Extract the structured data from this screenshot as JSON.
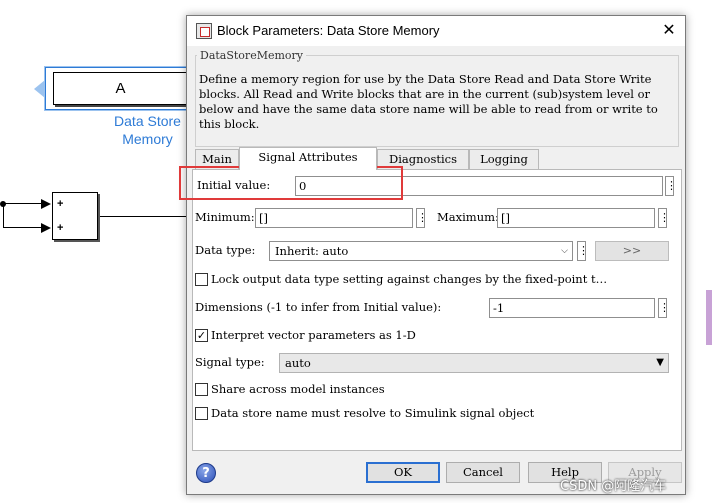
{
  "canvas": {
    "dsm_block_label": "A",
    "dsm_caption_line1": "Data Store",
    "dsm_caption_line2": "Memory",
    "sum_signs": [
      "+",
      "+"
    ]
  },
  "dialog": {
    "title": "Block Parameters: Data Store Memory",
    "close_glyph": "✕",
    "group_title": "DataStoreMemory",
    "description": "Define a memory region for use by the Data Store Read and Data Store Write blocks. All Read and Write blocks that are in the current (sub)system level or below and have the same data store name will be able to read from or write to this block.",
    "tabs": [
      {
        "label": "Main",
        "active": false
      },
      {
        "label": "Signal Attributes",
        "active": true
      },
      {
        "label": "Diagnostics",
        "active": false
      },
      {
        "label": "Logging",
        "active": false
      }
    ],
    "signal_attributes": {
      "initial_value_label": "Initial value:",
      "initial_value": "0",
      "minimum_label": "Minimum:",
      "minimum_value": "[]",
      "maximum_label": "Maximum:",
      "maximum_value": "[]",
      "data_type_label": "Data type:",
      "data_type_value": "Inherit: auto",
      "data_type_assistant": ">>",
      "lock_label": "Lock output data type setting against changes by the fixed-point t…",
      "lock_checked": false,
      "dimensions_label": "Dimensions (-1 to infer from Initial value):",
      "dimensions_value": "-1",
      "interpret_label": "Interpret vector parameters as 1-D",
      "interpret_checked": true,
      "signal_type_label": "Signal type:",
      "signal_type_value": "auto",
      "share_label": "Share across model instances",
      "share_checked": false,
      "resolve_label": "Data store name must resolve to Simulink signal object",
      "resolve_checked": false
    },
    "kebab_glyph": "⋮",
    "help_glyph": "?",
    "buttons": {
      "ok": "OK",
      "cancel": "Cancel",
      "help": "Help",
      "apply": "Apply"
    }
  },
  "colors": {
    "highlight": "#e03a3a",
    "selection_blue": "#2e7bd6"
  },
  "watermark": "CSDN @阿隆汽车"
}
